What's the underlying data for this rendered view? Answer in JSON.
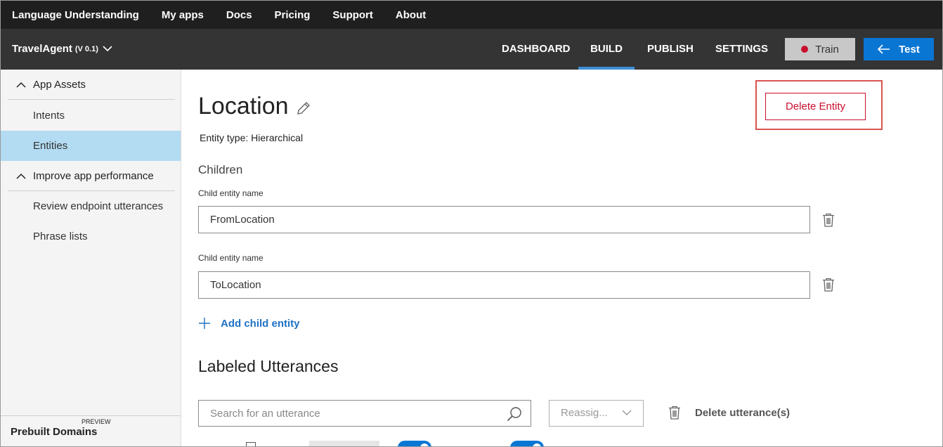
{
  "topnav": {
    "items": [
      "Language Understanding",
      "My apps",
      "Docs",
      "Pricing",
      "Support",
      "About"
    ]
  },
  "appbar": {
    "app_name": "TravelAgent",
    "version": "(V 0.1)",
    "tabs": [
      "DASHBOARD",
      "BUILD",
      "PUBLISH",
      "SETTINGS"
    ],
    "active_tab": "BUILD",
    "train_label": "Train",
    "test_label": "Test"
  },
  "sidebar": {
    "section1": "App Assets",
    "items1": [
      "Intents",
      "Entities"
    ],
    "active_item": "Entities",
    "section2": "Improve app performance",
    "items2": [
      "Review endpoint utterances",
      "Phrase lists"
    ],
    "bottom_label": "Prebuilt Domains",
    "bottom_badge": "PREVIEW"
  },
  "entity": {
    "name": "Location",
    "type_text": "Entity type: Hierarchical",
    "delete_label": "Delete Entity"
  },
  "children": {
    "heading": "Children",
    "field_label": "Child entity name",
    "items": [
      "FromLocation",
      "ToLocation"
    ],
    "add_label": "Add child entity"
  },
  "utterances": {
    "heading": "Labeled Utterances",
    "search_placeholder": "Search for an utterance",
    "reassign_label": "Reassig...",
    "delete_label": "Delete utterance(s)"
  },
  "colors": {
    "accent": "#0a76d4",
    "danger": "#c8102e",
    "active_sidebar": "#b3dbf2"
  }
}
